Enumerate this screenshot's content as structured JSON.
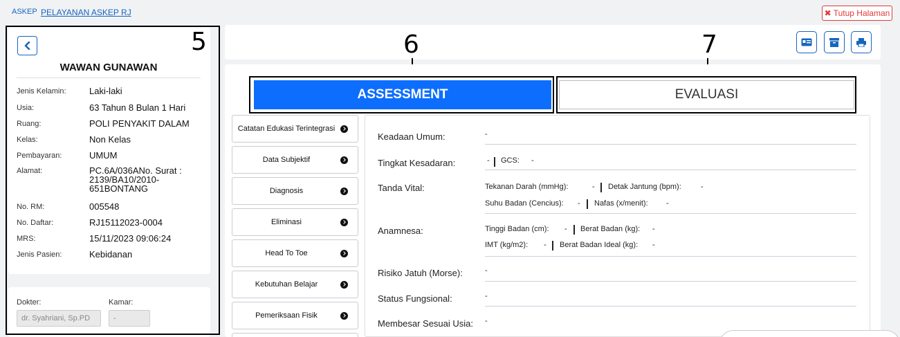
{
  "breadcrumb": {
    "root": "ASKEP",
    "current": "PELAYANAN ASKEP RJ"
  },
  "close_button": {
    "label": "Tutup Halaman"
  },
  "annotations": {
    "panel": "5",
    "assessment": "6",
    "evaluasi": "7"
  },
  "patient": {
    "name": "WAWAN GUNAWAN",
    "fields": [
      {
        "label": "Jenis Kelamin:",
        "value": "Laki-laki"
      },
      {
        "label": "Usia:",
        "value": "63 Tahun 8 Bulan 1 Hari"
      },
      {
        "label": "Ruang:",
        "value": "POLI PENYAKIT DALAM"
      },
      {
        "label": "Kelas:",
        "value": "Non Kelas"
      },
      {
        "label": "Pembayaran:",
        "value": "UMUM"
      },
      {
        "label": "Alamat:",
        "value": "PC.6A/036ANo. Surat : 2139/BA10/2010-651BONTANG"
      },
      {
        "label": "No. RM:",
        "value": "005548"
      },
      {
        "label": "No. Daftar:",
        "value": "RJ15112023-0004"
      },
      {
        "label": "MRS:",
        "value": "15/11/2023 09:06:24"
      },
      {
        "label": "Jenis Pasien:",
        "value": "Kebidanan"
      }
    ]
  },
  "doctor": {
    "doctor_label": "Dokter:",
    "doctor_value": "dr. Syahriani, Sp.PD",
    "room_label": "Kamar:",
    "room_value": "-"
  },
  "tabs": {
    "assessment": "ASSESSMENT",
    "evaluasi": "EVALUASI"
  },
  "menu": [
    "Catatan Edukasi Terintegrasi",
    "Data Subjektif",
    "Diagnosis",
    "Eliminasi",
    "Head To Toe",
    "Kebutuhan Belajar",
    "Pemeriksaan Fisik"
  ],
  "assessment": {
    "keadaan_umum": {
      "label": "Keadaan Umum:",
      "value": "-"
    },
    "tingkat_kesadaran": {
      "label": "Tingkat Kesadaran:",
      "value": "-",
      "gcs_label": "GCS:",
      "gcs_value": "-"
    },
    "tanda_vital": {
      "label": "Tanda Vital:",
      "td_label": "Tekanan Darah (mmHg):",
      "td_value": "-",
      "dj_label": "Detak Jantung (bpm):",
      "dj_value": "-",
      "sb_label": "Suhu Badan (Cencius):",
      "sb_value": "-",
      "nf_label": "Nafas (x/menit):",
      "nf_value": "-"
    },
    "anamnesa": {
      "label": "Anamnesa:",
      "tb_label": "Tinggi Badan (cm):",
      "tb_value": "-",
      "bb_label": "Berat Badan (kg):",
      "bb_value": "-",
      "imt_label": "IMT (kg/m2):",
      "imt_value": "-",
      "bbi_label": "Berat Badan Ideal (kg):",
      "bbi_value": "-"
    },
    "risiko_jatuh": {
      "label": "Risiko Jatuh (Morse):",
      "value": "-"
    },
    "status_fungsional": {
      "label": "Status Fungsional:",
      "value": "-"
    },
    "membesar": {
      "label": "Membesar Sesuai Usia:",
      "value": "-"
    }
  }
}
